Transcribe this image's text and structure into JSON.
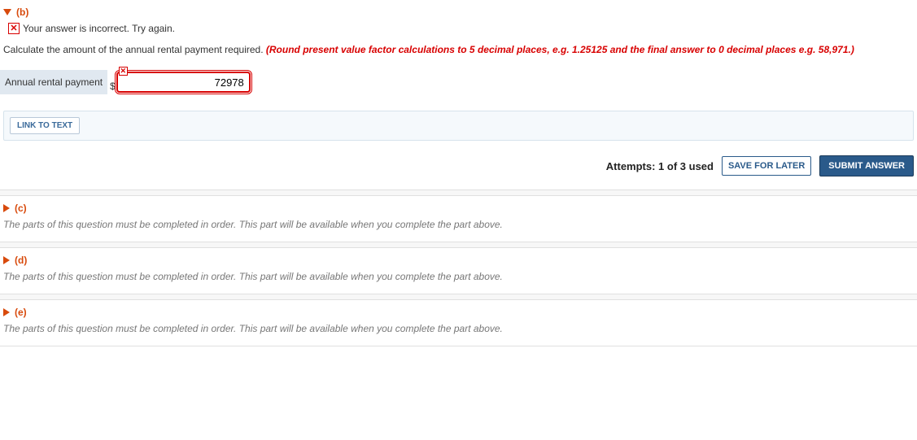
{
  "part_b": {
    "label": "(b)",
    "feedback": "Your answer is incorrect.  Try again.",
    "question_prefix": "Calculate the amount of the annual rental payment required.",
    "rounding_hint": "(Round present value factor calculations to 5 decimal places, e.g. 1.25125 and the final answer to 0 decimal places e.g. 58,971.)",
    "input_label": "Annual rental payment",
    "currency": "$",
    "input_value": "72978",
    "link_button": "LINK TO TEXT",
    "attempts": "Attempts: 1 of 3 used",
    "save_button": "SAVE FOR LATER",
    "submit_button": "SUBMIT ANSWER"
  },
  "locked_message": "The parts of this question must be completed in order. This part will be available when you complete the part above.",
  "part_c": {
    "label": "(c)"
  },
  "part_d": {
    "label": "(d)"
  },
  "part_e": {
    "label": "(e)"
  }
}
